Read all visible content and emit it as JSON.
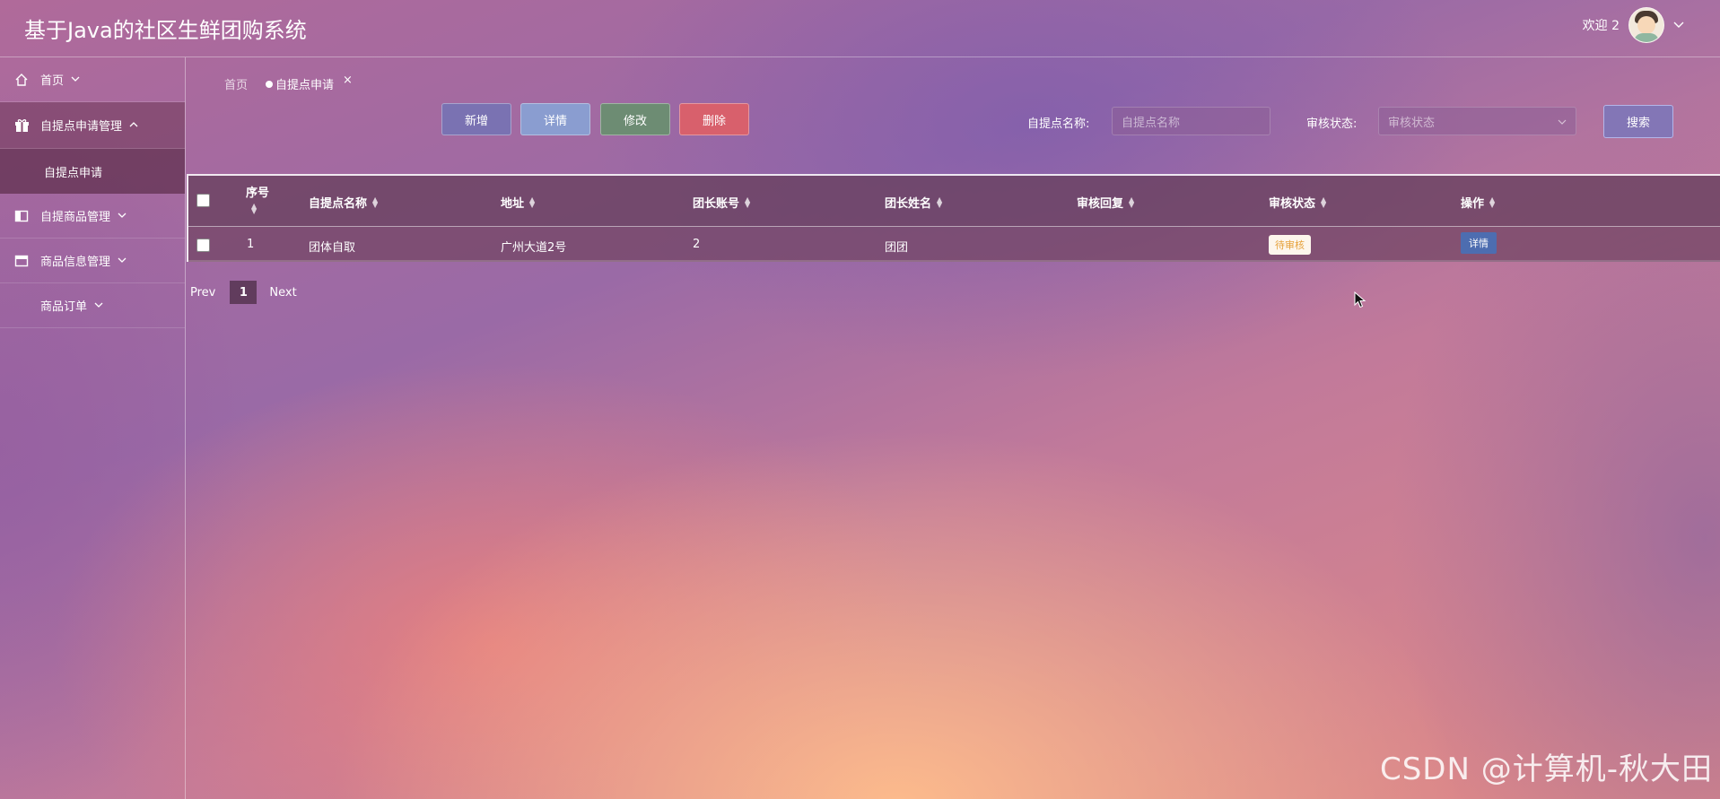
{
  "header": {
    "title": "基于Java的社区生鲜团购系统",
    "welcome": "欢迎 2"
  },
  "sidebar": {
    "items": [
      {
        "label": "首页",
        "icon": "home-icon"
      },
      {
        "label": "自提点申请管理",
        "icon": "gift-icon"
      },
      {
        "label": "自提点申请"
      },
      {
        "label": "自提商品管理",
        "icon": "layout-icon"
      },
      {
        "label": "商品信息管理",
        "icon": "card-icon"
      },
      {
        "label": "商品订单"
      }
    ]
  },
  "breadcrumb": {
    "home": "首页",
    "current": "自提点申请",
    "close": "×"
  },
  "toolbar": {
    "add": "新增",
    "detail": "详情",
    "edit": "修改",
    "delete": "删除"
  },
  "search": {
    "name_label": "自提点名称:",
    "name_placeholder": "自提点名称",
    "status_label": "审核状态:",
    "status_placeholder": "审核状态",
    "button": "搜索"
  },
  "table": {
    "headers": [
      "序号",
      "自提点名称",
      "地址",
      "团长账号",
      "团长姓名",
      "审核回复",
      "审核状态",
      "操作"
    ],
    "rows": [
      {
        "index": "1",
        "name": "团体自取",
        "address": "广州大道2号",
        "account": "2",
        "leader": "团团",
        "reply": "",
        "status": "待审核",
        "action": "详情"
      }
    ]
  },
  "pagination": {
    "prev": "Prev",
    "page": "1",
    "next": "Next"
  },
  "watermark": "CSDN @计算机-秋大田",
  "colors": {
    "add": "#7a72b2",
    "detail": "#8a9dd0",
    "edit": "#6d8c73",
    "delete": "#d8606c",
    "pending_text": "#e6a23c",
    "row_action": "#4d6db0"
  }
}
